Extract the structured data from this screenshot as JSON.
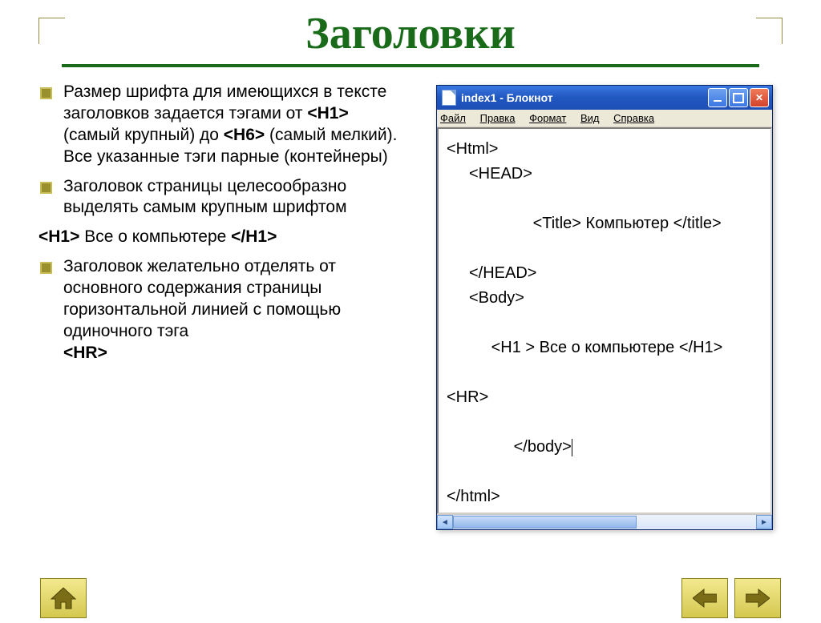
{
  "slide": {
    "title": "Заголовки",
    "bullets": {
      "b1_pre": "Размер шрифта для имеющихся в тексте заголовков задается тэгами от ",
      "b1_h1tag": "<H1>",
      "b1_mid1": " (самый крупный) до ",
      "b1_h6tag": "<H6>",
      "b1_post": " (самый мелкий). Все указанные тэги парные (контейнеры)",
      "b2": "Заголовок страницы целесообразно выделять самым крупным шрифтом",
      "plain_pre": "<H1>",
      "plain_mid": " Все о компьютере ",
      "plain_post": "</H1>",
      "b3_pre": "Заголовок желательно отделять от основного содержания страницы горизонтальной линией с помощью одиночного тэга ",
      "b3_tag": "<HR>"
    }
  },
  "notepad": {
    "title": "index1 - Блокнот",
    "menu": {
      "file": "Файл",
      "edit": "Правка",
      "format": "Формат",
      "view": "Вид",
      "help": "Справка"
    },
    "lines": {
      "l1": "<Html>",
      "l2": "<HEAD>",
      "l3_a": "<Title> ",
      "l3_b": "Компьютер ",
      "l3_c": "</title>",
      "l4": "</HEAD>",
      "l5": "<Body>",
      "l6_a": "<H1 > ",
      "l6_b": "Все о компьютере ",
      "l6_c": "</H1>",
      "l7": "<HR>",
      "l8": "</body>",
      "l9": "</html>"
    }
  }
}
